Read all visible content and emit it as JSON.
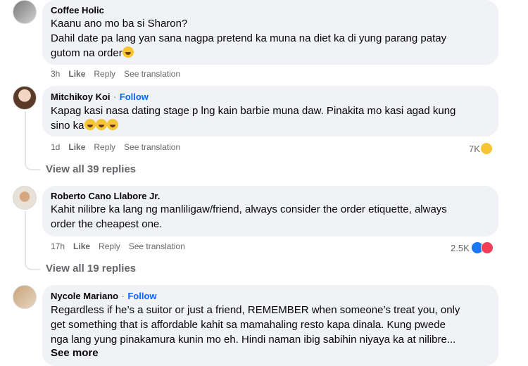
{
  "comments": [
    {
      "author": "Coffee Holic",
      "follow": "",
      "lines": [
        "Kaanu ano mo ba si Sharon?",
        "Dahil date pa lang yan sana nagpa pretend ka muna na diet ka di yung parang patay",
        "gutom na order"
      ],
      "time": "3h",
      "like": "Like",
      "reply": "Reply",
      "translate": "See translation",
      "reaction_count": ""
    },
    {
      "author": "Mitchikoy Koi",
      "follow": "Follow",
      "lines": [
        "Kapag kasi nasa dating stage p lng kain barbie muna daw. Pinakita mo kasi agad kung",
        "sino ka"
      ],
      "time": "1d",
      "like": "Like",
      "reply": "Reply",
      "translate": "See translation",
      "reaction_count": "7K",
      "view_replies": "View all 39 replies"
    },
    {
      "author": "Roberto Cano Llabore Jr.",
      "follow": "",
      "lines": [
        "Kahit nilibre ka lang ng manliligaw/friend, always consider the order etiquette, always",
        "order the cheapest one."
      ],
      "time": "17h",
      "like": "Like",
      "reply": "Reply",
      "translate": "See translation",
      "reaction_count": "2.5K",
      "view_replies": "View all 19 replies"
    },
    {
      "author": "Nycole Mariano",
      "follow": "Follow",
      "lines": [
        "Regardless if he’s a suitor or just a friend, REMEMBER when someone’s treat you, only",
        "get something that is affordable kahit sa mamahaling resto kapa dinala. Kung pwede",
        "nga lang yung pinakamura kunin mo eh. Hindi naman ibig sabihin niyaya ka at nilibre..."
      ],
      "see_more": "See more"
    }
  ],
  "dot": "·",
  "colors": {
    "bubble": "#f0f2f5",
    "follow": "#0866ff",
    "meta": "#65676b"
  },
  "icons": [
    "avatar",
    "laugh-emoji-icon",
    "like-reaction-icon",
    "love-reaction-icon",
    "haha-reaction-icon"
  ]
}
